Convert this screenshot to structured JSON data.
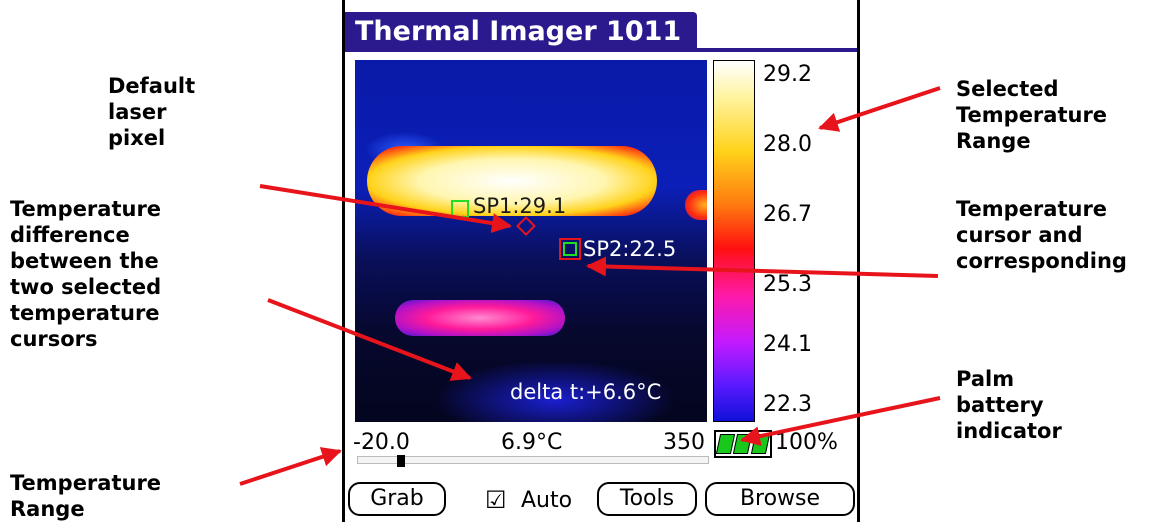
{
  "annotations": {
    "default_laser_pixel": "Default\nlaser\npixel",
    "temperature_difference": "Temperature\ndifference\nbetween the\ntwo selected\ntemperature\ncursors",
    "temperature_range": "Temperature\nRange",
    "selected_temperature_range": "Selected\nTemperature\nRange",
    "temperature_cursor": "Temperature\ncursor and\ncorresponding",
    "palm_battery": "Palm\nbattery\nindicator"
  },
  "app": {
    "title": "Thermal Imager 1011"
  },
  "image": {
    "cursor1_label": "SP1:29.1",
    "cursor2_label": "SP2:22.5",
    "delta_text": "delta t:+6.6°C"
  },
  "scale": {
    "ticks": [
      "29.2",
      "28.0",
      "26.7",
      "25.3",
      "24.1",
      "22.3"
    ]
  },
  "status": {
    "range_min": "-20.0",
    "center_temp": "6.9°C",
    "range_max": "350",
    "battery_percent": "100%",
    "battery_level": 1.0,
    "range_thumb_value": -12
  },
  "buttons": {
    "grab": "Grab",
    "auto_check": "☑",
    "auto": "Auto",
    "tools": "Tools",
    "browse": "Browse"
  },
  "colors": {
    "title_bar": "#2b1a8e",
    "annotation_arrow": "#e8141b",
    "battery_cell": "#18c81a",
    "cursor_green": "#22dd22",
    "cursor_red": "#e8141b"
  }
}
